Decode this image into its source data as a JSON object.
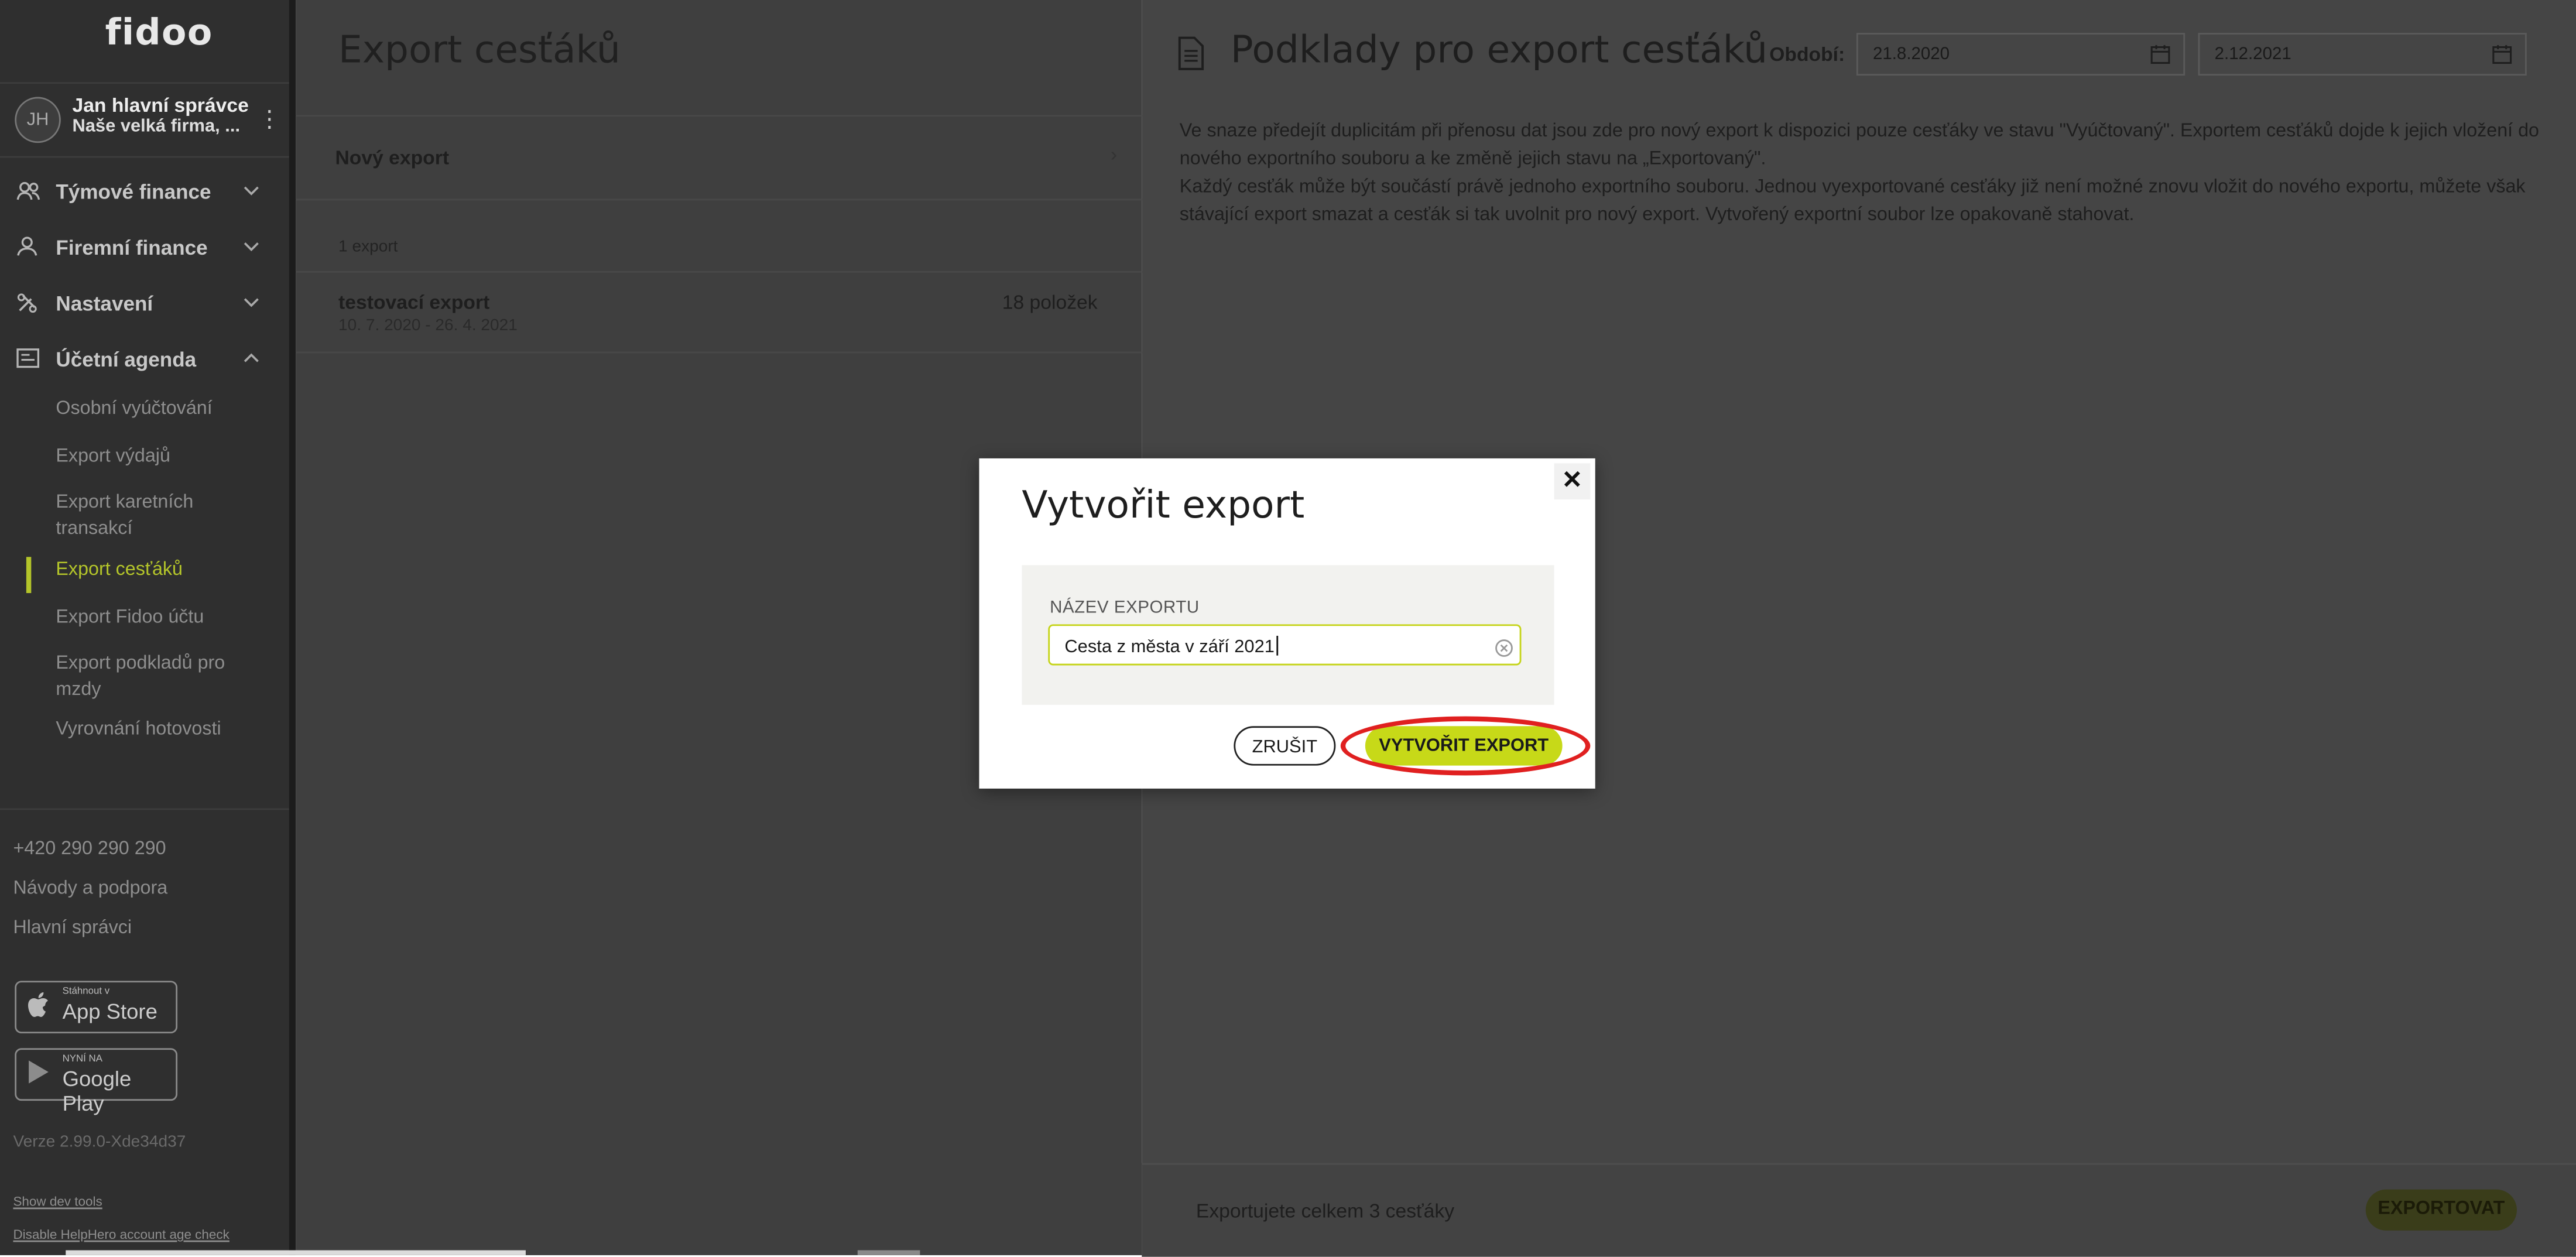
{
  "sidebar": {
    "logo": "fidoo",
    "user": {
      "initials": "JH",
      "name": "Jan hlavní správce",
      "company": "Naše velká firma, ..."
    },
    "nav": [
      {
        "label": "Týmové finance",
        "icon": "team-icon",
        "expanded": false
      },
      {
        "label": "Firemní finance",
        "icon": "person-icon",
        "expanded": false
      },
      {
        "label": "Nastavení",
        "icon": "settings-icon",
        "expanded": false
      },
      {
        "label": "Účetní agenda",
        "icon": "ledger-icon",
        "expanded": true
      }
    ],
    "sub_items": [
      "Osobní vyúčtování",
      "Export výdajů",
      "Export karetních transakcí",
      "Export cesťáků",
      "Export Fidoo účtu",
      "Export podkladů pro mzdy",
      "Vyrovnání hotovosti"
    ],
    "active_sub_item": "Export cesťáků",
    "phone": "+420 290 290 290",
    "help_link": "Návody a podpora",
    "role_link": "Hlavní správci",
    "app_store": {
      "small": "Stáhnout v",
      "big": "App Store"
    },
    "google_play": {
      "small": "NYNÍ NA",
      "big": "Google Play"
    },
    "version": "Verze 2.99.0-Xde34d37",
    "dev_tools_link": "Show dev tools",
    "helphero_link": "Disable HelpHero account age check"
  },
  "middle": {
    "title": "Export cesťáků",
    "new_export_label": "Nový export",
    "count_label": "1 export",
    "exports": [
      {
        "name": "testovací export",
        "dates": "10. 7. 2020 - 26. 4. 2021",
        "items": "18 položek"
      }
    ]
  },
  "right": {
    "title": "Podklady pro export cesťáků",
    "period_label": "Období:",
    "date_from": "21.8.2020",
    "date_to": "2.12.2021",
    "info_1": "Ve snaze předejít duplicitám při přenosu dat jsou zde pro nový export k dispozici pouze cesťáky ve stavu \"Vyúčtovaný\". Exportem cesťáků dojde k jejich vložení do nového exportního souboru a ke změně jejich stavu na „Exportovaný\".",
    "info_2": "Každý cesťák může být součástí právě jednoho exportního souboru. Jednou vyexportované cesťáky již není možné znovu vložit do nového exportu, můžete však stávající export smazat a cesťák si tak uvolnit pro nový export. Vytvořený exportní soubor lze opakovaně stahovat.",
    "footer_text": "Exportujete celkem 3 cesťáky",
    "export_button": "EXPORTOVAT"
  },
  "modal": {
    "title": "Vytvořit export",
    "close": "✕",
    "field_label": "NÁZEV EXPORTU",
    "field_value": "Cesta z města v září 2021",
    "cancel_button": "ZRUŠIT",
    "create_button": "VYTVOŘIT EXPORT"
  },
  "colors": {
    "accent": "#c7d918",
    "highlight": "#e02020",
    "sidebar_bg": "#2f2f2f"
  }
}
